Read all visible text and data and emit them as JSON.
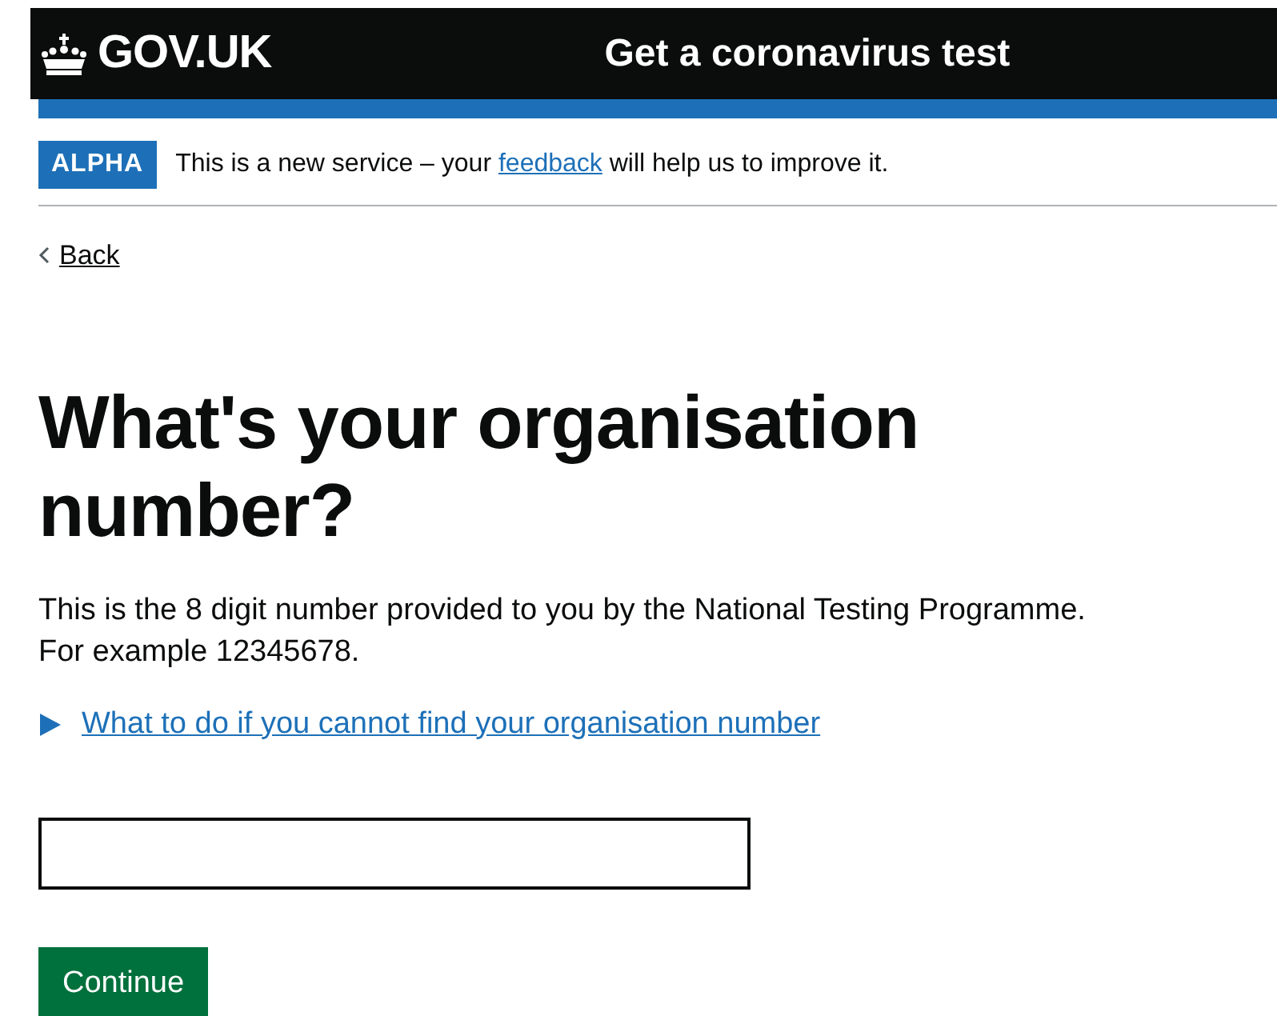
{
  "header": {
    "logo": "GOV.UK",
    "service_name": "Get a coronavirus test"
  },
  "phase_banner": {
    "tag": "ALPHA",
    "text_before": "This is a new service – your",
    "link": "feedback",
    "text_after": "will help us to improve it."
  },
  "back_link": "Back",
  "heading": "What's your organisation number?",
  "hint_lines": [
    "This is the 8 digit number provided to you by the National Testing Programme.",
    "For example 12345678."
  ],
  "details": {
    "summary": "What to do if you cannot find your organisation number",
    "expanded": false
  },
  "button": "Continue"
}
